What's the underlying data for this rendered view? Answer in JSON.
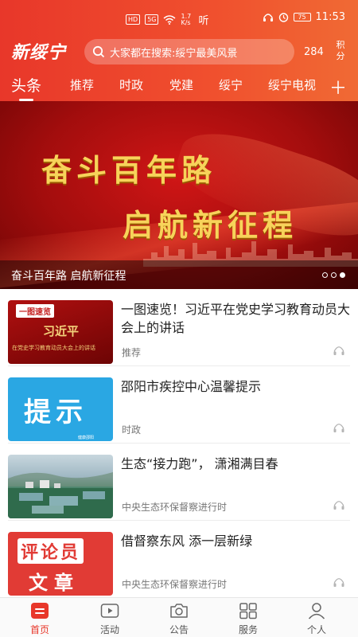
{
  "status_bar": {
    "net_tags": [
      "HD",
      "5G"
    ],
    "speed": "1.7 K/s",
    "ting": "听",
    "battery": "75",
    "time": "11:53"
  },
  "header": {
    "logo": "新绥宁",
    "search_placeholder": "大家都在搜索:绥宁最美风景",
    "points_value": "284",
    "points_label": "积分"
  },
  "tabs": [
    {
      "label": "头条",
      "active": true
    },
    {
      "label": "推荐"
    },
    {
      "label": "时政"
    },
    {
      "label": "党建"
    },
    {
      "label": "绥宁"
    },
    {
      "label": "绥宁电视"
    }
  ],
  "tab_add_icon": "plus-icon",
  "banner": {
    "line1": "奋斗百年路",
    "line2": "启航新征程",
    "caption": "奋斗百年路 启航新征程",
    "dots": 3,
    "active_dot": 2
  },
  "news": [
    {
      "title": "一图速览！习近平在党史学习教育动员大会上的讲话",
      "source": "推荐",
      "thumb": {
        "label": "一图速览",
        "name": "习近平",
        "sub": "在党史学习教育动员大会上的讲话"
      }
    },
    {
      "title": "邵阳市疾控中心温馨提示",
      "source": "时政",
      "thumb": {
        "big": "提示",
        "small": "健康邵阳"
      }
    },
    {
      "title": "生态“接力跑”， 潇湘满目春",
      "source": "中央生态环保督察进行时",
      "thumb": {}
    },
    {
      "title": "借督察东风 添一层新绿",
      "source": "中央生态环保督察进行时",
      "thumb": {
        "row1": "评论员",
        "row2": "文章"
      }
    }
  ],
  "bottom_nav": [
    {
      "label": "首页",
      "icon": "home-icon",
      "active": true
    },
    {
      "label": "活动",
      "icon": "video-icon"
    },
    {
      "label": "公告",
      "icon": "camera-icon"
    },
    {
      "label": "服务",
      "icon": "grid-icon"
    },
    {
      "label": "个人",
      "icon": "person-icon"
    }
  ],
  "colors": {
    "brand": "#e8372a",
    "gold": "#f7d35a"
  }
}
